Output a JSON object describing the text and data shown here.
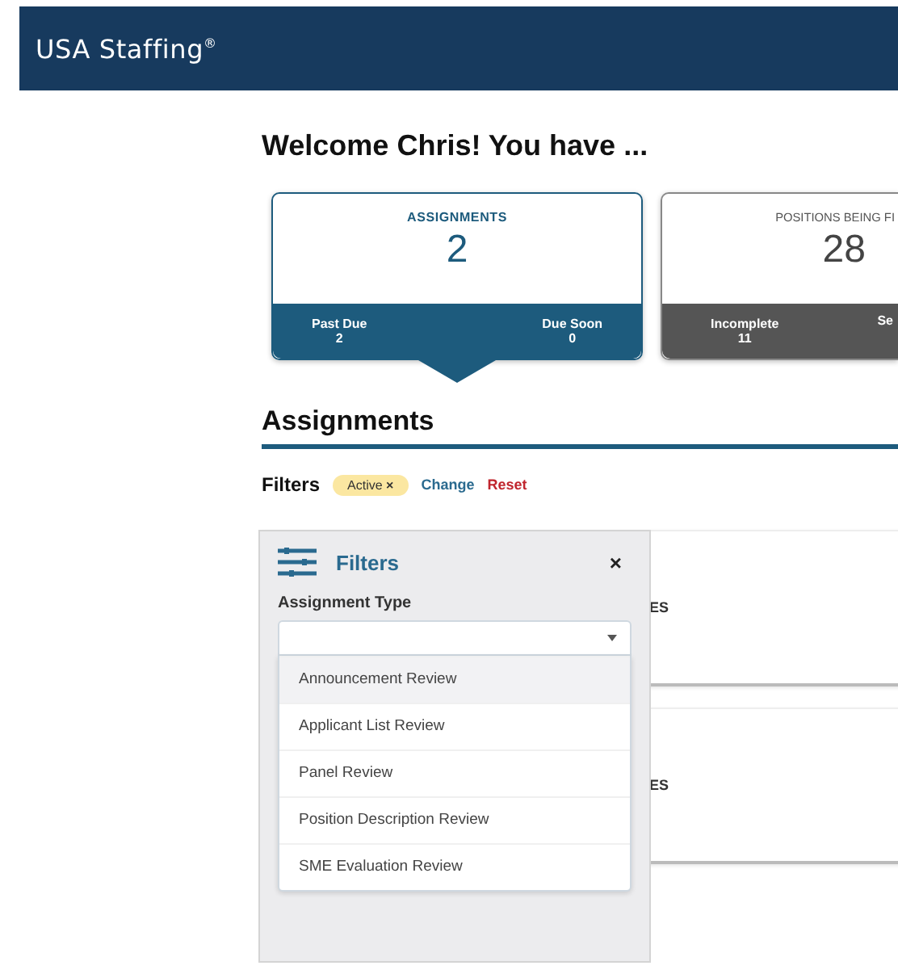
{
  "header": {
    "logo": "USA Staffing$^{®}$"
  },
  "welcome": "Welcome Chris! You have ...",
  "summary_cards": [
    {
      "title": "ASSIGNMENTS",
      "count": "2",
      "selected": true,
      "stats": [
        {
          "label": "Past Due",
          "value": "2"
        },
        {
          "label": "Due Soon",
          "value": "0"
        }
      ]
    },
    {
      "title": "POSITIONS BEING FI",
      "count": "28",
      "selected": false,
      "stats": [
        {
          "label": "Incomplete",
          "value": "11"
        },
        {
          "label": "Se"
        }
      ]
    }
  ],
  "section_title": "Assignments",
  "filters_bar": {
    "label": "Filters",
    "chip": {
      "label": "Active",
      "remove": "×"
    },
    "change": "Change",
    "reset": "Reset"
  },
  "result_cards": [
    {
      "text": "ES"
    },
    {
      "text": "ES"
    }
  ],
  "filter_panel": {
    "title": "Filters",
    "close": "×",
    "field_label": "Assignment Type",
    "options": [
      {
        "label": "Announcement Review",
        "highlighted": true
      },
      {
        "label": "Applicant List Review",
        "highlighted": false
      },
      {
        "label": "Panel Review",
        "highlighted": false
      },
      {
        "label": "Position Description Review",
        "highlighted": false
      },
      {
        "label": "SME Evaluation Review",
        "highlighted": false
      }
    ]
  }
}
